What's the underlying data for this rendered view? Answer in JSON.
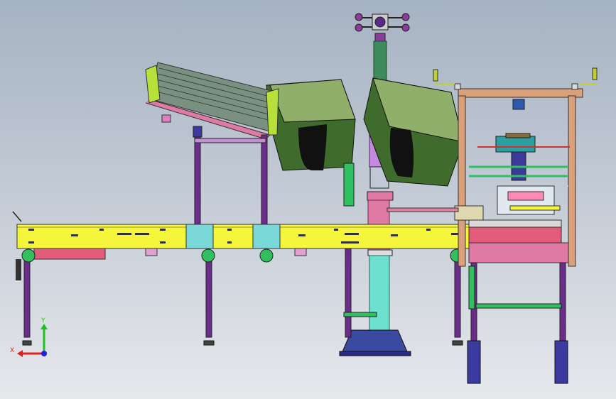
{
  "viewport": {
    "background_top": "#a6b3c2",
    "background_bottom": "#e6e8ec"
  },
  "colors": {
    "conveyor_yellow": "#f5f53c",
    "leg_purple": "#6b2c8c",
    "hopper_green": "#3f6b2c",
    "hopper_light": "#8faf6a",
    "column_green": "#3d8a5a",
    "column_cyan": "#6ee0d0",
    "frame_orange": "#d9a07a",
    "pink": "#e07aa5",
    "salmon": "#e35c7a",
    "navy": "#2a2a8a"
  },
  "axis_triad": {
    "x_label": "X",
    "y_label": "Y",
    "x_color": "#e02020",
    "y_color": "#20c020",
    "z_color": "#2020e0"
  }
}
